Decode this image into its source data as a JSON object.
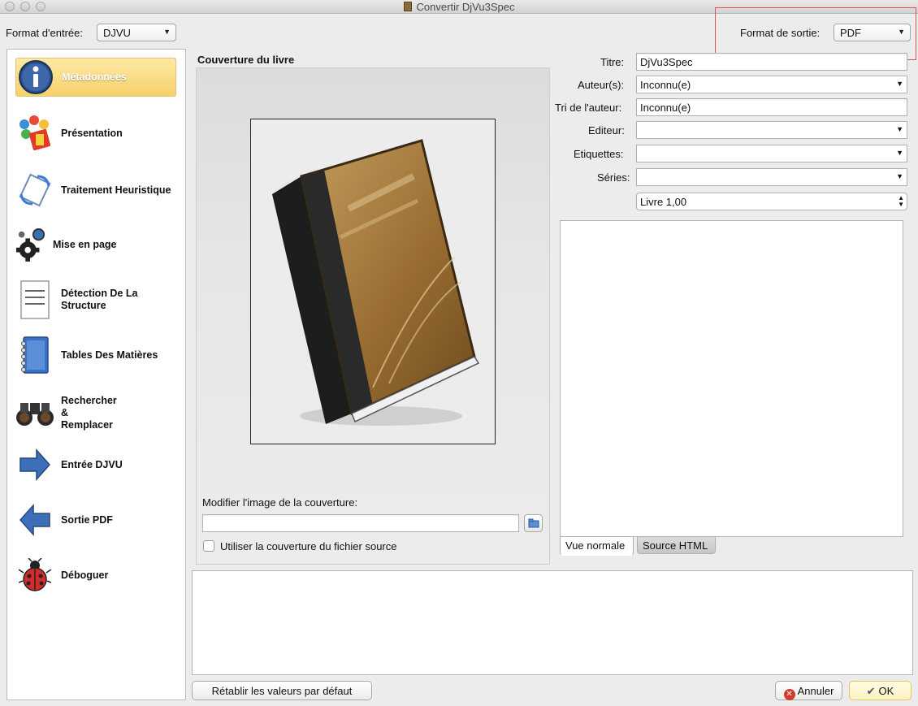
{
  "window": {
    "title": "Convertir DjVu3Spec"
  },
  "input_format": {
    "label": "Format d'entrée:",
    "value": "DJVU"
  },
  "output_format": {
    "label": "Format de sortie:",
    "value": "PDF"
  },
  "sidebar": {
    "items": [
      {
        "label": "Métadonnées",
        "icon": "info-icon",
        "active": true
      },
      {
        "label": "Présentation",
        "icon": "palette-icon",
        "active": false
      },
      {
        "label": "Traitement Heuristique",
        "icon": "heuristic-icon",
        "active": false
      },
      {
        "label": "Mise en page",
        "icon": "gears-icon",
        "active": false
      },
      {
        "label": "Détection De La Structure",
        "icon": "document-lines-icon",
        "active": false
      },
      {
        "label": "Tables Des Matières",
        "icon": "notebook-icon",
        "active": false
      },
      {
        "label": "Rechercher & Remplacer",
        "icon": "binoculars-icon",
        "active": false
      },
      {
        "label": "Entrée DJVU",
        "icon": "arrow-right-icon",
        "active": false
      },
      {
        "label": "Sortie PDF",
        "icon": "arrow-left-icon",
        "active": false
      },
      {
        "label": "Déboguer",
        "icon": "ladybug-icon",
        "active": false
      }
    ]
  },
  "cover": {
    "section_title": "Couverture du livre",
    "change_label": "Modifier l'image de la couverture:",
    "path_value": "",
    "browse_icon": "folder-browse-icon",
    "use_source_label": "Utiliser la couverture du fichier source",
    "use_source_checked": false
  },
  "metadata": {
    "title_label": "Titre:",
    "title_value": "DjVu3Spec",
    "author_label": "Auteur(s):",
    "author_value": "Inconnu(e)",
    "author_sort_label": "Tri de l'auteur:",
    "author_sort_value": "Inconnu(e)",
    "publisher_label": "Editeur:",
    "publisher_value": "",
    "tags_label": "Etiquettes:",
    "tags_value": "",
    "series_label": "Séries:",
    "series_value": "",
    "series_index_value": "Livre 1,00"
  },
  "comment_tabs": [
    {
      "label": "Vue normale",
      "active": true
    },
    {
      "label": "Source HTML",
      "active": false
    }
  ],
  "buttons": {
    "reset_label": "Rétablir les valeurs par défaut",
    "cancel_label": "Annuler",
    "ok_label": "OK"
  },
  "colors": {
    "highlight": "#e05050",
    "active_item": "#f7d06a"
  }
}
